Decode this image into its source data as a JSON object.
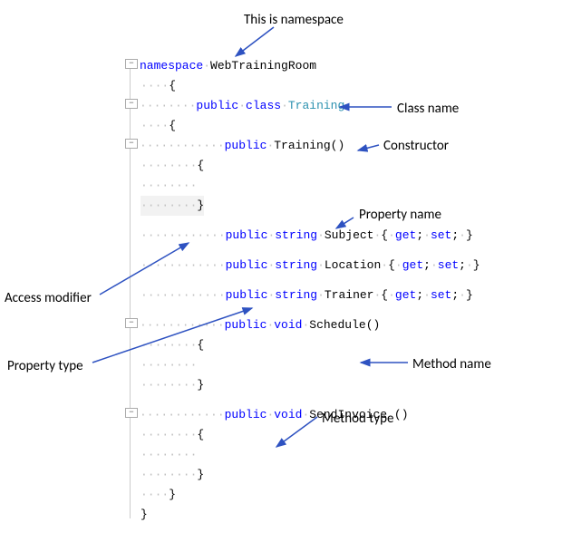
{
  "annotations": {
    "namespace": "This is namespace",
    "class_name": "Class name",
    "constructor": "Constructor",
    "property_name": "Property name",
    "access_modifier": "Access modifier",
    "property_type": "Property type",
    "method_name": "Method name",
    "method_type": "Method type"
  },
  "code": {
    "kw_namespace": "namespace",
    "ns_name": "WebTrainingRoom",
    "kw_public": "public",
    "kw_class": "class",
    "class_name": "Training",
    "ctor_name": "Training",
    "kw_string": "string",
    "prop1": "Subject",
    "prop2": "Location",
    "prop3": "Trainer",
    "kw_get": "get",
    "kw_set": "set",
    "kw_void": "void",
    "method1": "Schedule",
    "method2": "SendInvoice",
    "lbrace": "{",
    "rbrace": "}",
    "parens": "()",
    "semicolon": ";",
    "space": " ",
    "collapse": "−",
    "dots4": "····",
    "dots8": "········",
    "dots12": "············"
  },
  "colors": {
    "arrow": "#2e52c1"
  }
}
